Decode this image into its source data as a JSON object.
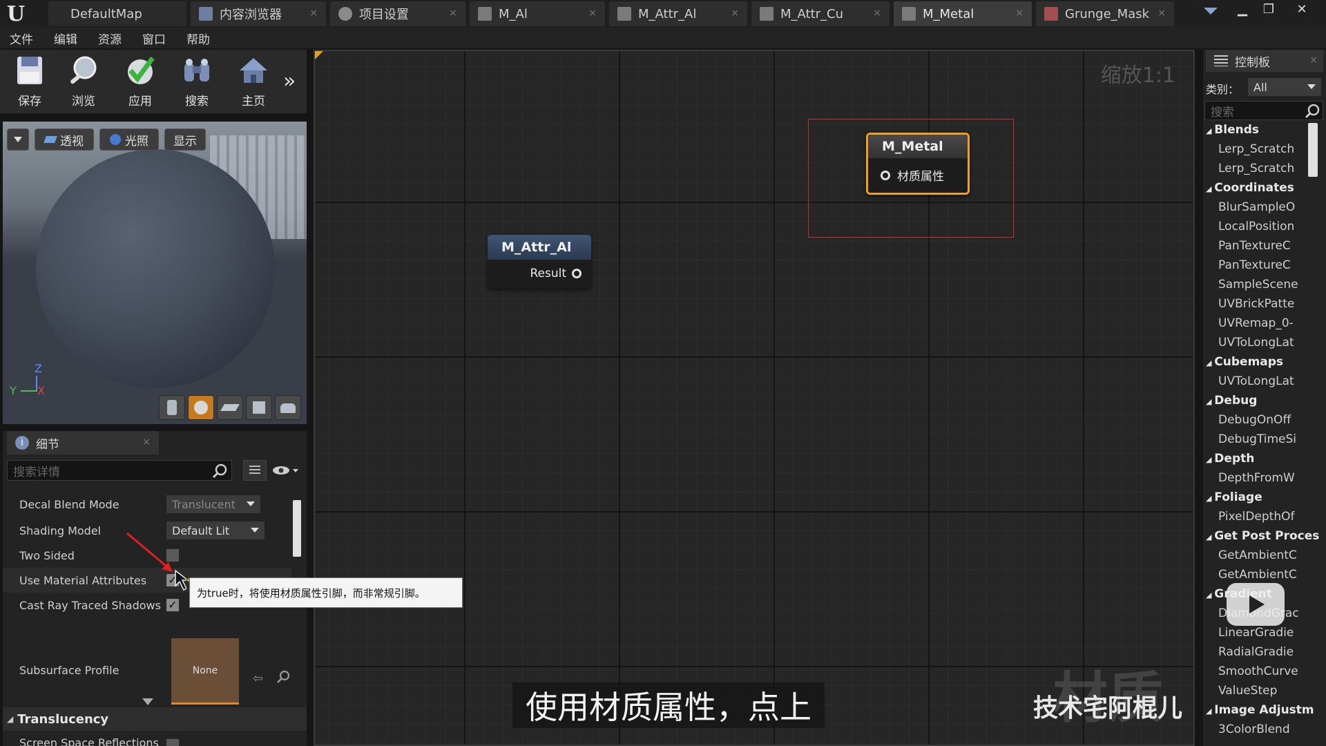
{
  "tabs": [
    {
      "label": "DefaultMap"
    },
    {
      "label": "内容浏览器"
    },
    {
      "label": "项目设置"
    },
    {
      "label": "M_Al"
    },
    {
      "label": "M_Attr_Al"
    },
    {
      "label": "M_Attr_Cu"
    },
    {
      "label": "M_Metal"
    },
    {
      "label": "Grunge_Mask"
    }
  ],
  "menu": [
    "文件",
    "编辑",
    "资源",
    "窗口",
    "帮助"
  ],
  "toolbar": {
    "save": "保存",
    "browse": "浏览",
    "apply": "应用",
    "search": "搜索",
    "home": "主页",
    "more": "»"
  },
  "viewport": {
    "perspective": "透视",
    "lit": "光照",
    "show": "显示",
    "axis_z": "Z",
    "axis_x": "X",
    "axis_y": "Y"
  },
  "details": {
    "tab": "细节",
    "search_placeholder": "搜索详情",
    "rows": [
      {
        "label": "Decal Blend Mode",
        "value": "Translucent"
      },
      {
        "label": "Shading Model",
        "value": "Default Lit"
      },
      {
        "label": "Two Sided"
      },
      {
        "label": "Use Material Attributes",
        "check": "✓"
      },
      {
        "label": "Cast Ray Traced Shadows",
        "check": "✓"
      },
      {
        "label": "Subsurface Profile",
        "value": "None",
        "combo": "无"
      }
    ],
    "tooltip": "为true时，将使用材质属性引脚，而非常规引脚。",
    "section": "Translucency",
    "next_row": "Screen Space Reflections"
  },
  "graph": {
    "zoom": "缩放1:1",
    "node_attr": {
      "title": "M_Attr_Al",
      "output": "Result"
    },
    "node_metal": {
      "title": "M_Metal",
      "input": "材质属性"
    }
  },
  "palette": {
    "tab": "控制板",
    "category_label": "类别：",
    "category_value": "All",
    "search_placeholder": "搜索",
    "entries": [
      {
        "cat": "Blends"
      },
      {
        "item": "Lerp_Scratch"
      },
      {
        "item": "Lerp_Scratch"
      },
      {
        "cat": "Coordinates"
      },
      {
        "item": "BlurSampleO"
      },
      {
        "item": "LocalPosition"
      },
      {
        "item": "PanTextureC"
      },
      {
        "item": "PanTextureC"
      },
      {
        "item": "SampleScene"
      },
      {
        "item": "UVBrickPatte"
      },
      {
        "item": "UVRemap_0-"
      },
      {
        "item": "UVToLongLat"
      },
      {
        "cat": "Cubemaps"
      },
      {
        "item": "UVToLongLat"
      },
      {
        "cat": "Debug"
      },
      {
        "item": "DebugOnOff"
      },
      {
        "item": "DebugTimeSi"
      },
      {
        "cat": "Depth"
      },
      {
        "item": "DepthFromW"
      },
      {
        "cat": "Foliage"
      },
      {
        "item": "PixelDepthOf"
      },
      {
        "cat": "Get Post Proces"
      },
      {
        "item": "GetAmbientC"
      },
      {
        "item": "GetAmbientC"
      },
      {
        "cat": "Gradient"
      },
      {
        "item": "DiamondGrac"
      },
      {
        "item": "LinearGradie"
      },
      {
        "item": "RadialGradie"
      },
      {
        "item": "SmoothCurve"
      },
      {
        "item": "ValueStep"
      },
      {
        "cat": "Image Adjustm"
      },
      {
        "item": "3ColorBlend"
      }
    ]
  },
  "overlay": {
    "subtitle": "使用材质属性，点上",
    "watermark": "技术宅阿棍儿",
    "watermark_bg": "材质"
  },
  "colors": {
    "accent_orange": "#f0a020",
    "selection_red": "#c83030",
    "node_head_blue": "#33475e"
  }
}
